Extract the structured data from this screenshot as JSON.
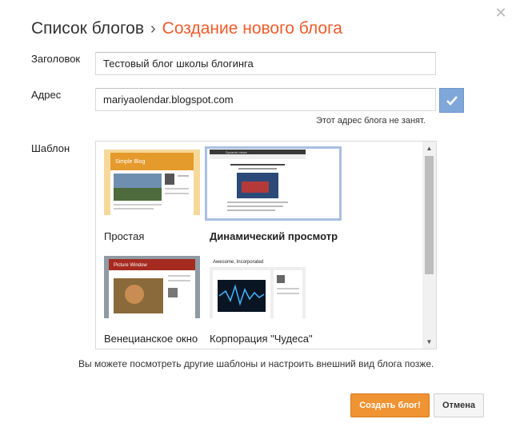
{
  "dialog": {
    "close_glyph": "✕"
  },
  "header": {
    "breadcrumb_root": "Список блогов",
    "separator": "›",
    "current": "Создание нового блога"
  },
  "form": {
    "title_label": "Заголовок",
    "title_value": "Тестовый блог школы блогинга",
    "address_label": "Адрес",
    "address_value": "mariyaolendar.blogspot.com",
    "address_status": "Этот адрес блога не занят.",
    "template_label": "Шаблон"
  },
  "templates": [
    {
      "name": "Простая",
      "selected": false,
      "thumb_title": "Simple Blog"
    },
    {
      "name": "Динамический просмотр",
      "selected": true,
      "thumb_title": "Dynamic views"
    },
    {
      "name": "Венецианское окно",
      "selected": false,
      "thumb_title": "Picture Window"
    },
    {
      "name": "Корпорация \"Чудеса\"",
      "selected": false,
      "thumb_title": "Awesome, Incorporated"
    }
  ],
  "footer": {
    "note": "Вы можете посмотреть другие шаблоны и настроить внешний вид блога позже.",
    "create_button": "Создать блог!",
    "cancel_button": "Отмена"
  },
  "colors": {
    "accent_orange": "#f05b2a",
    "create_button": "#f09332",
    "check_button": "#7fa7d9",
    "selection_border": "#a9bfdf"
  }
}
